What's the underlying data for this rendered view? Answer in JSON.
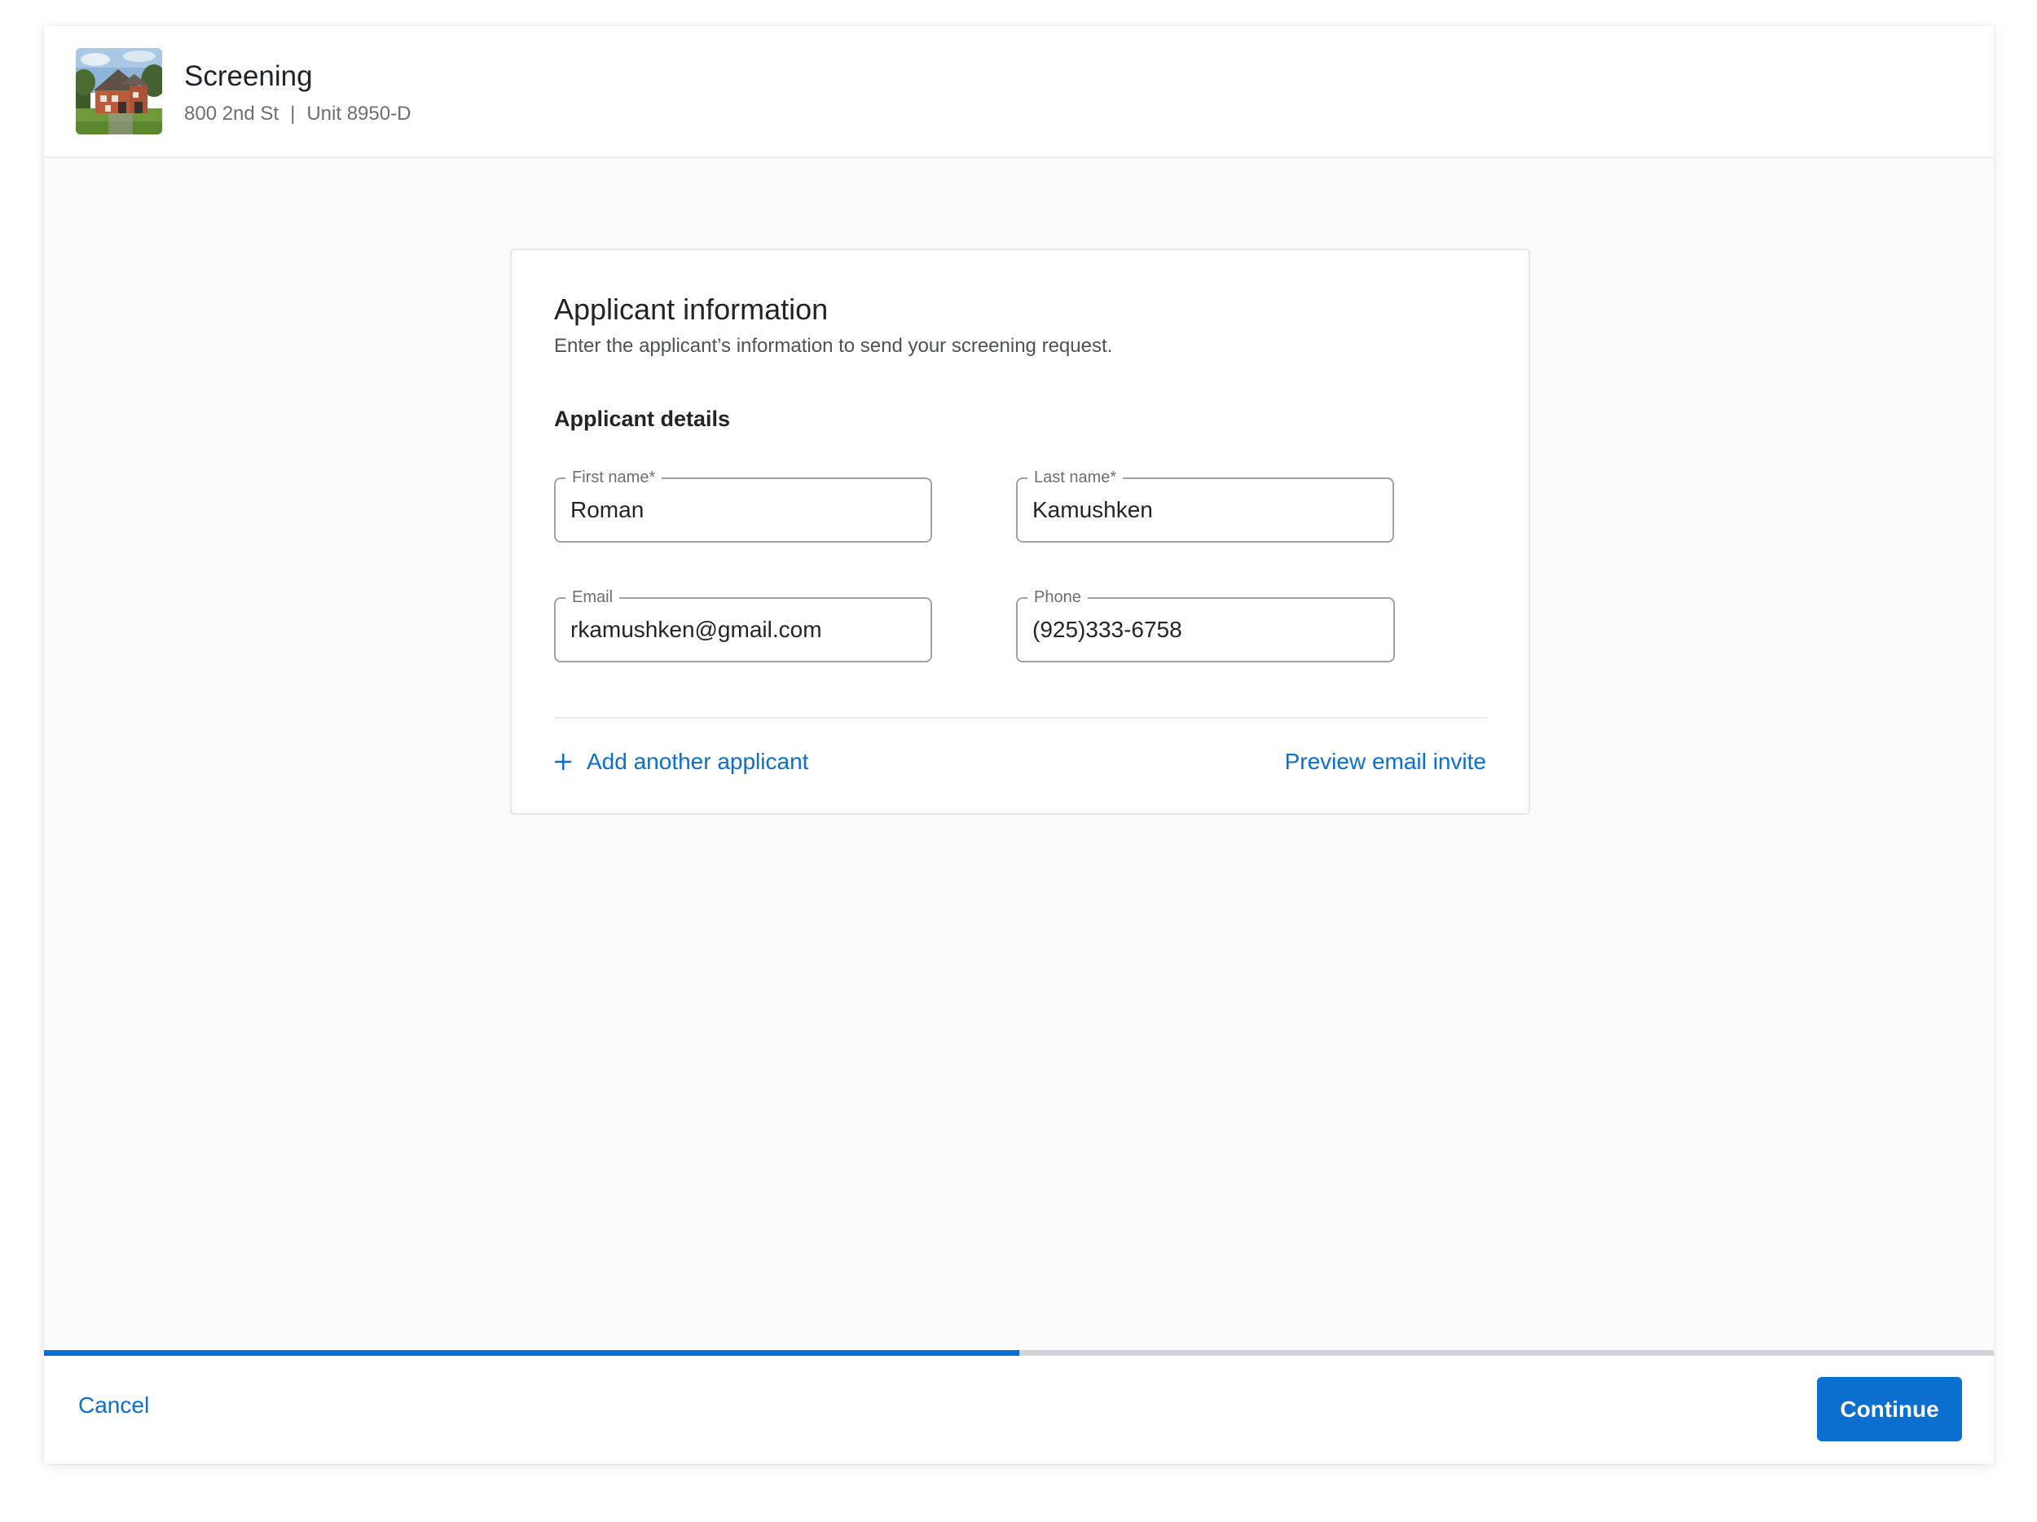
{
  "header": {
    "title": "Screening",
    "address": "800 2nd St",
    "separator": "|",
    "unit": "Unit 8950-D",
    "thumbnail_icon": "house-photo"
  },
  "card": {
    "title": "Applicant information",
    "description": "Enter the applicant’s information to send your screening request.",
    "section_title": "Applicant details",
    "fields": {
      "first_name": {
        "label": "First name*",
        "value": "Roman"
      },
      "last_name": {
        "label": "Last name*",
        "value": "Kamushken"
      },
      "email": {
        "label": "Email",
        "value": "rkamushken@gmail.com"
      },
      "phone": {
        "label": "Phone",
        "value": "(925)333-6758"
      }
    },
    "add_applicant_label": "Add another applicant",
    "add_applicant_icon": "plus-icon",
    "preview_label": "Preview email invite"
  },
  "progress": {
    "fraction": 0.5
  },
  "footer": {
    "cancel_label": "Cancel",
    "continue_label": "Continue"
  },
  "colors": {
    "accent": "#0a6fcf",
    "progress_track": "#d3d5d8",
    "field_border": "#9ea2a7"
  }
}
